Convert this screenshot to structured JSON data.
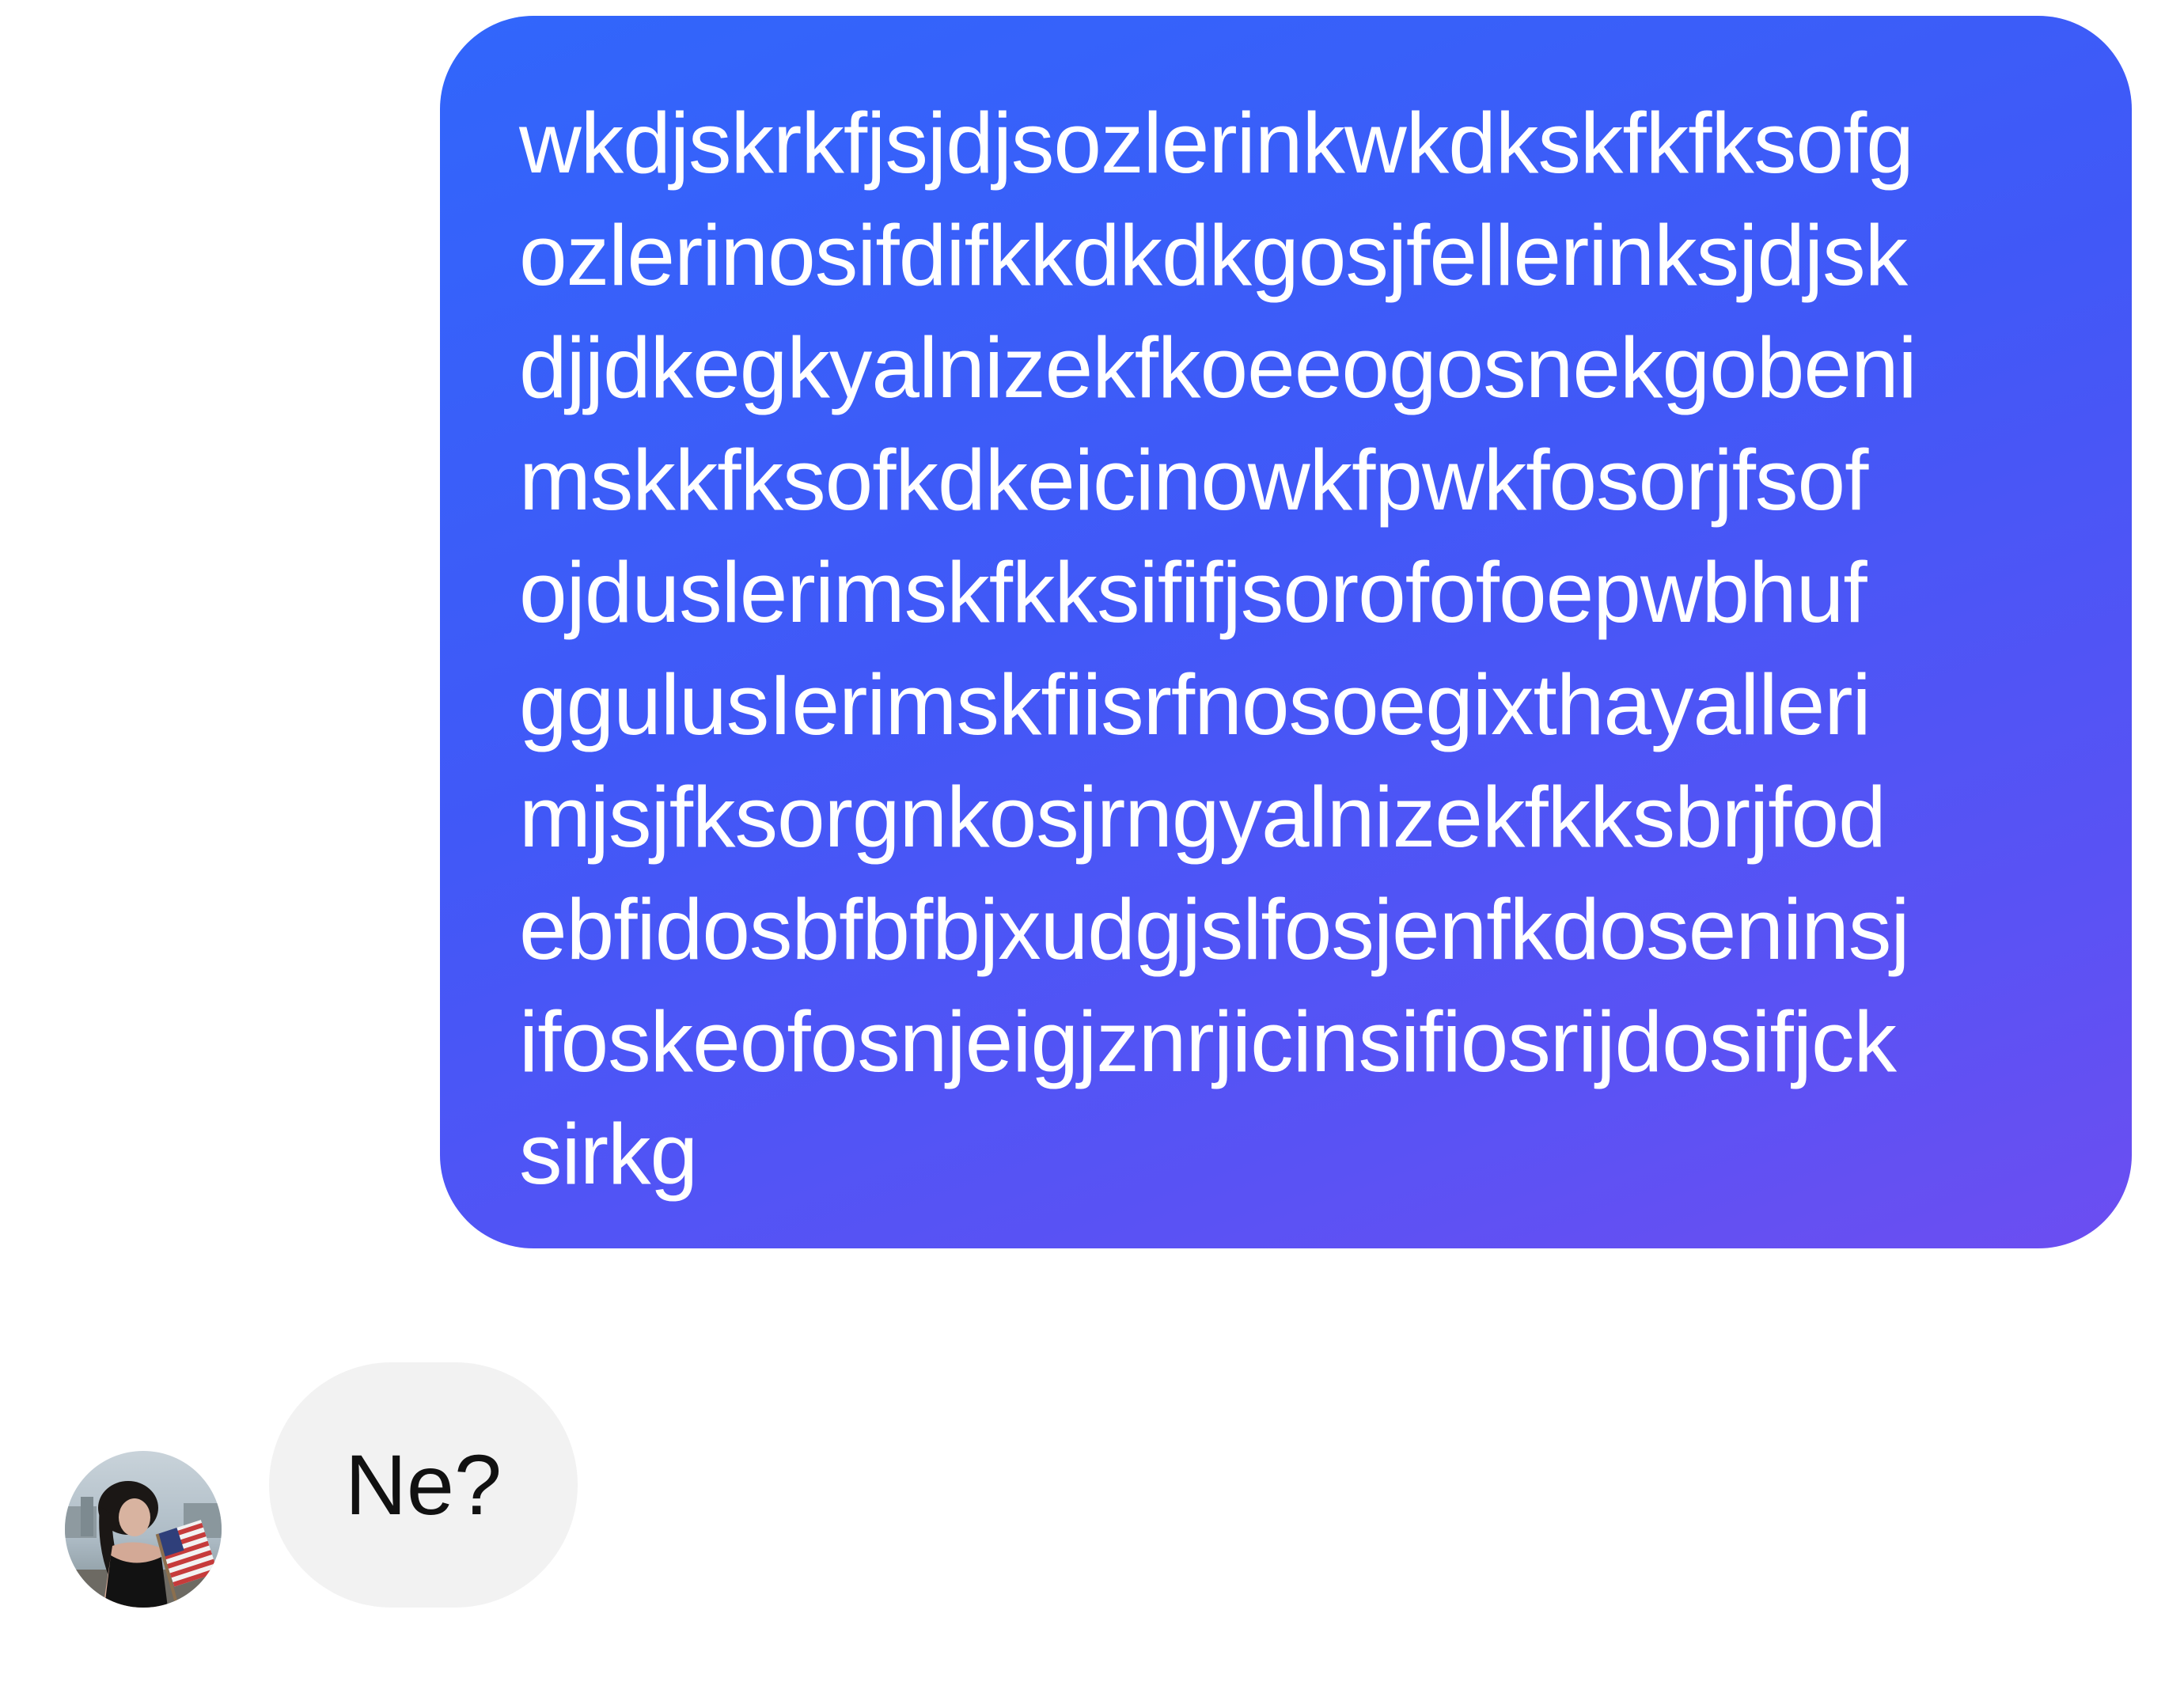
{
  "conversation": {
    "outgoing_message": {
      "lines": [
        "wkdjskrkfjsjdjsozlerinkwkdkskfkfksofg",
        "ozlerinosifdifkkdkdkgosjfellerinksjdjsk",
        "djjdkegkyalnizekfkoeeogosnekgobeni",
        "mskkfksofkdkeicinowkfpwkfosorjfsof",
        "ojduslerimskfkksififjsorofofoepwbhuf",
        "ggulusIerimskfiisrfnosoegixthayalleri",
        "mjsjfksorgnkosjrngyalnizekfkksbrjfod",
        "ebfidosbfbfbjxudgjslfosjenfkdoseninsj",
        "ifoskeofosnjeigjznrjicinsifiosrijdosifjck",
        "sirkg"
      ]
    },
    "incoming_message": {
      "text": "Ne?"
    }
  },
  "colors": {
    "outgoing_gradient_start": "#3166fb",
    "outgoing_gradient_end": "#6c4ef1",
    "incoming_bubble": "#f2f2f2"
  }
}
